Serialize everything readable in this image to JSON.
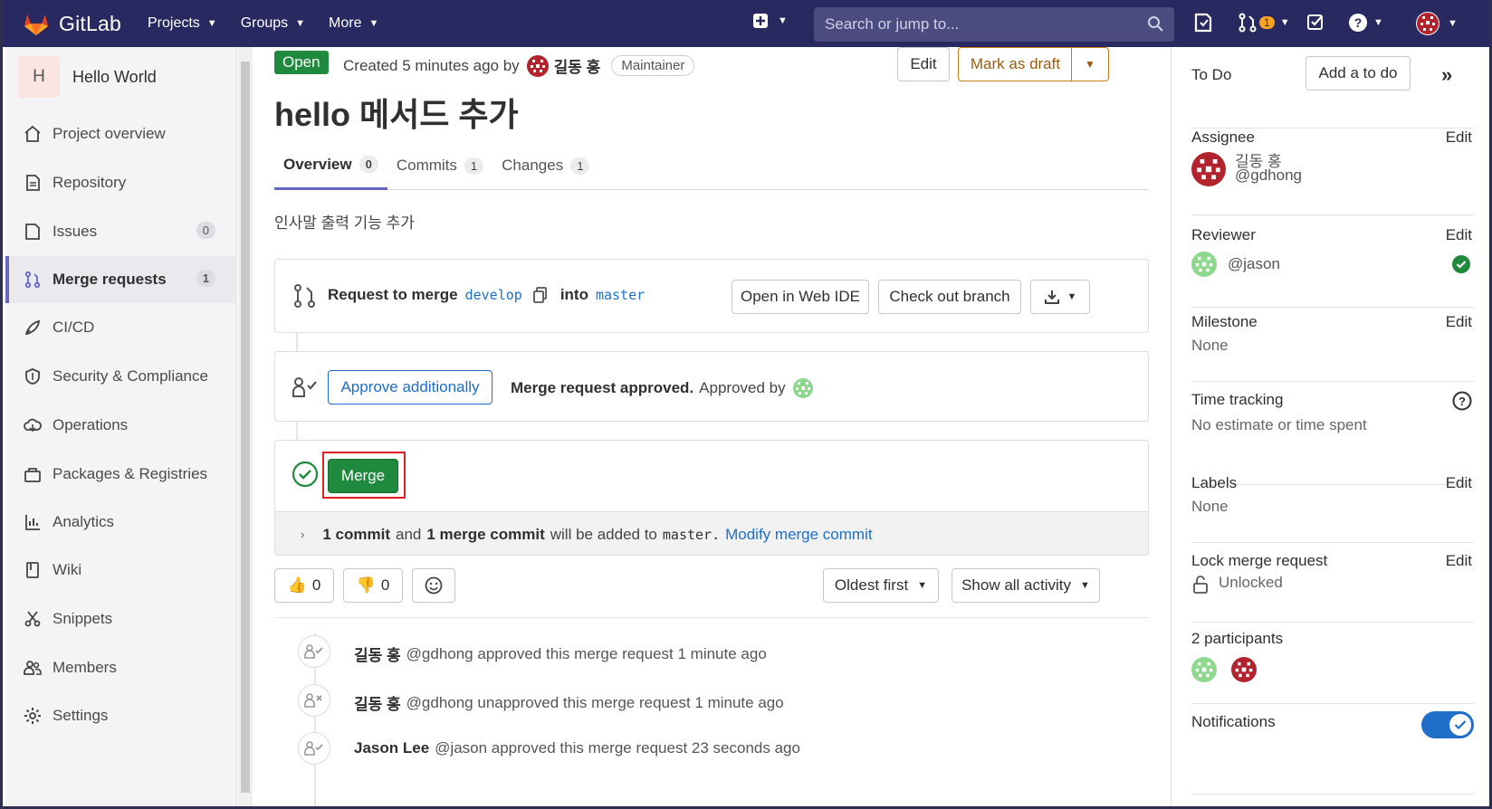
{
  "topnav": {
    "brand": "GitLab",
    "menus": [
      "Projects",
      "Groups",
      "More"
    ],
    "search_placeholder": "Search or jump to...",
    "mr_count": "1"
  },
  "sidebar": {
    "project_initial": "H",
    "project_name": "Hello World",
    "items": [
      {
        "label": "Project overview",
        "icon": "home-icon"
      },
      {
        "label": "Repository",
        "icon": "doc-icon"
      },
      {
        "label": "Issues",
        "icon": "issues-icon",
        "count": "0"
      },
      {
        "label": "Merge requests",
        "icon": "merge-request-icon",
        "count": "1"
      },
      {
        "label": "CI/CD",
        "icon": "rocket-icon"
      },
      {
        "label": "Security & Compliance",
        "icon": "shield-icon"
      },
      {
        "label": "Operations",
        "icon": "cloud-icon"
      },
      {
        "label": "Packages & Registries",
        "icon": "package-icon"
      },
      {
        "label": "Analytics",
        "icon": "chart-icon"
      },
      {
        "label": "Wiki",
        "icon": "book-icon"
      },
      {
        "label": "Snippets",
        "icon": "scissors-icon"
      },
      {
        "label": "Members",
        "icon": "users-icon"
      },
      {
        "label": "Settings",
        "icon": "gear-icon"
      }
    ]
  },
  "mr": {
    "status": "Open",
    "created_text": "Created 5 minutes ago by",
    "author": "길동 홍",
    "role": "Maintainer",
    "edit": "Edit",
    "mark_draft": "Mark as draft",
    "title": "hello 메서드 추가",
    "tabs": [
      {
        "label": "Overview",
        "count": "0"
      },
      {
        "label": "Commits",
        "count": "1"
      },
      {
        "label": "Changes",
        "count": "1"
      }
    ],
    "description": "인사말 출력 기능 추가",
    "request_to_merge": "Request to merge",
    "source_branch": "develop",
    "into": "into",
    "target_branch": "master",
    "open_web_ide": "Open in Web IDE",
    "checkout_branch": "Check out branch",
    "approve_additionally": "Approve additionally",
    "approved_bold": "Merge request approved.",
    "approved_by": "Approved by",
    "merge_button": "Merge",
    "commit_info": {
      "n1": "1 commit",
      "and": "and",
      "n2": "1 merge commit",
      "mid": "will be added to",
      "branch": "master.",
      "link": "Modify merge commit"
    },
    "thumbs_up": "0",
    "thumbs_down": "0",
    "sort": "Oldest first",
    "filter": "Show all activity",
    "activity": [
      {
        "name": "길동 홍",
        "text": "@gdhong approved this merge request 1 minute ago"
      },
      {
        "name": "길동 홍",
        "text": "@gdhong unapproved this merge request 1 minute ago"
      },
      {
        "name": "Jason Lee",
        "text": "@jason approved this merge request 23 seconds ago"
      }
    ]
  },
  "right": {
    "todo": "To Do",
    "add_todo": "Add a to do",
    "assignee_label": "Assignee",
    "assignee_name": "길동 홍",
    "assignee_user": "@gdhong",
    "reviewer_label": "Reviewer",
    "reviewer_user": "@jason",
    "milestone_label": "Milestone",
    "milestone_val": "None",
    "time_label": "Time tracking",
    "time_val": "No estimate or time spent",
    "labels_label": "Labels",
    "labels_val": "None",
    "lock_label": "Lock merge request",
    "lock_val": "Unlocked",
    "participants": "2 participants",
    "notifications": "Notifications",
    "edit": "Edit"
  },
  "colors": {
    "nav": "#292961",
    "green": "#1f8a3e",
    "link": "#1f6fc8",
    "accent": "#6666c4",
    "highlight": "#e02020"
  }
}
